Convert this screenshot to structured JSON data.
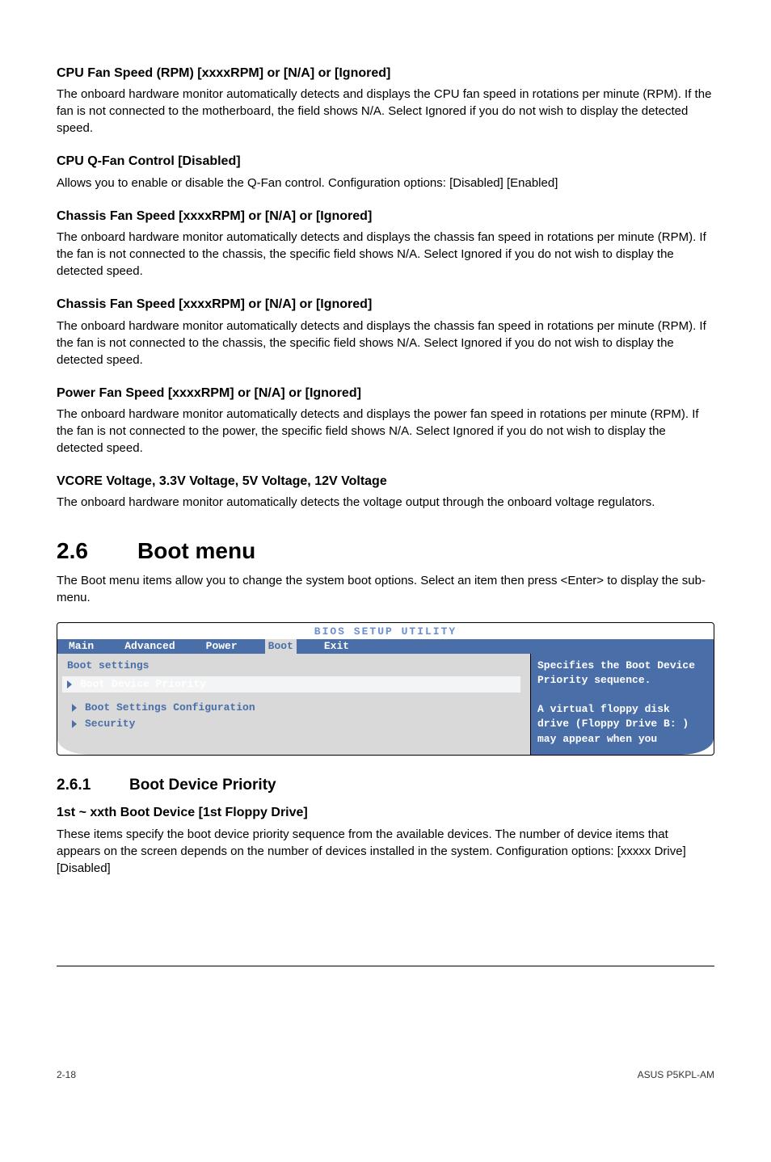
{
  "sections": {
    "cpuFanSpeed": {
      "title": "CPU Fan Speed (RPM) [xxxxRPM] or [N/A] or [Ignored]",
      "body": "The onboard hardware monitor automatically detects and displays the CPU fan speed in rotations per minute (RPM). If the fan is not connected to the motherboard, the field shows N/A. Select Ignored if you do not wish to display the detected speed."
    },
    "cpuQFan": {
      "title": "CPU Q-Fan Control [Disabled]",
      "body": "Allows you to enable or disable the Q-Fan control. Configuration options: [Disabled] [Enabled]"
    },
    "chassisFan1": {
      "title": "Chassis Fan Speed [xxxxRPM] or [N/A] or [Ignored]",
      "body": "The onboard hardware monitor automatically detects and displays the chassis fan speed in rotations per minute (RPM). If the fan is not connected to the chassis, the specific field shows N/A. Select Ignored if you do not wish to display the detected speed."
    },
    "chassisFan2": {
      "title": "Chassis Fan Speed [xxxxRPM] or [N/A] or [Ignored]",
      "body": "The onboard hardware monitor automatically detects and displays the chassis fan speed in rotations per minute (RPM). If the fan is not connected to the chassis, the specific field shows N/A. Select Ignored if you do not wish to display the detected speed."
    },
    "powerFan": {
      "title": "Power Fan Speed [xxxxRPM] or [N/A] or [Ignored]",
      "body": "The onboard hardware monitor automatically detects and displays the power fan speed in rotations per minute (RPM). If the fan is not connected to the power, the specific field shows N/A. Select Ignored if you do not wish to display the detected speed."
    },
    "vcore": {
      "title": "VCORE Voltage, 3.3V Voltage, 5V Voltage, 12V Voltage",
      "body": "The onboard hardware monitor automatically detects the voltage output through the onboard voltage regulators."
    }
  },
  "bootMenu": {
    "num": "2.6",
    "title": "Boot menu",
    "body": "The Boot menu items allow you to change the system boot options. Select an item then press <Enter> to display the sub-menu."
  },
  "bios": {
    "title": "BIOS SETUP UTILITY",
    "tabs": {
      "main": "Main",
      "advanced": "Advanced",
      "power": "Power",
      "boot": "Boot",
      "exit": "Exit"
    },
    "heading": "Boot settings",
    "items": {
      "priority": "Boot Device Priority",
      "config": "Boot Settings Configuration",
      "security": "Security"
    },
    "help": "Specifies the Boot Device Priority sequence.\n\nA virtual floppy disk drive (Floppy Drive B: ) may appear when you"
  },
  "bootDevice": {
    "num": "2.6.1",
    "title": "Boot Device Priority",
    "subTitle": "1st ~ xxth Boot Device [1st Floppy Drive]",
    "body": "These items specify the boot device priority sequence from the available devices. The number of device items that appears on the screen depends on the number of devices installed in the system. Configuration options: [xxxxx Drive] [Disabled]"
  },
  "footer": {
    "left": "2-18",
    "right": "ASUS P5KPL-AM"
  }
}
